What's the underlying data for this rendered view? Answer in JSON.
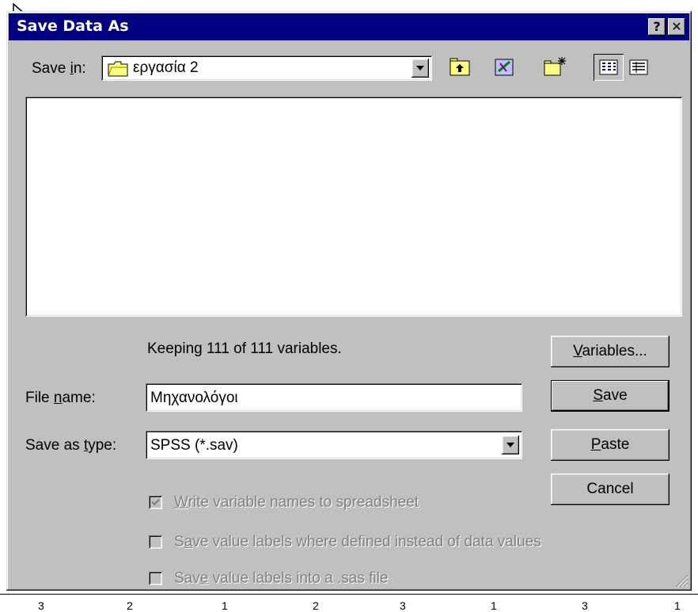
{
  "window": {
    "title": "Save Data As",
    "help_button": "?",
    "close_button": "✕"
  },
  "save_in": {
    "label_pre": "Save ",
    "label_key": "i",
    "label_post": "n:",
    "folder": "εργασία 2"
  },
  "info": {
    "keeping_text": "Keeping 111 of 111 variables."
  },
  "file_name": {
    "label_pre": "File ",
    "label_key": "n",
    "label_post": "ame:",
    "value": "Μηχανολόγοι"
  },
  "save_type": {
    "label_pre": "Save as ",
    "label_key": "t",
    "label_post": "ype:",
    "value": "SPSS (*.sav)"
  },
  "buttons": {
    "variables_key": "V",
    "variables_rest": "ariables...",
    "save_key": "S",
    "save_rest": "ave",
    "paste_key": "P",
    "paste_rest": "aste",
    "cancel": "Cancel"
  },
  "options": {
    "write_names_key": "W",
    "write_names_rest": "rite variable names to spreadsheet",
    "write_names_checked": true,
    "value_labels_key": "a",
    "value_labels_pre": "S",
    "value_labels_rest": "ve value labels where defined instead of data values",
    "sas_file_pre": "Sav",
    "sas_file_key": "e",
    "sas_file_rest": " value labels into a .sas file"
  },
  "background": {
    "ruler_digits": [
      "3",
      "2",
      "1",
      "2",
      "3",
      "1",
      "3",
      "1"
    ]
  }
}
